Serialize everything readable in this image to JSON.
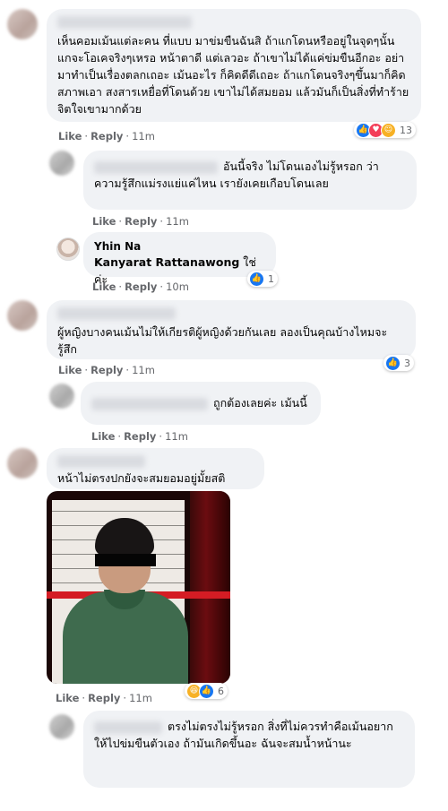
{
  "labels": {
    "like": "Like",
    "reply": "Reply",
    "dot": "·"
  },
  "comments": [
    {
      "text": "เห็นคอมเม้นแต่ละคน ที่แบบ มาข่มขืนฉันสิ ถ้าแกโดนหรืออยู่ในจุดๆนั้น แกจะโอเคจริงๆเหรอ หน้าตาดี แต่เลวอะ ถ้าเขาไม่ได้แค่ข่มขืนอีกอะ อย่ามาทำเป็นเรื่องตลกเถอะ เม้นอะไร ก็คิดดีดีเถอะ ถ้าแกโดนจริงๆขึ้นมาก็คิดสภาพเอา สงสารเหยื่อที่โดนด้วย เขาไม่ได้สมยอม แล้วมันก็เป็นสิ่งที่ทำร้ายจิตใจเขามากด้วย",
      "time": "11m",
      "reactions": {
        "count": "13",
        "icons": [
          "like-reaction",
          "love-reaction",
          "care-reaction"
        ]
      }
    },
    {
      "text": "อันนี้จริง ไม่โดนเองไม่รู้หรอก ว่าความรู้สึกแม่รงแย่แค่ไหน เรายังเคยเกือบโดนเลย",
      "time": "11m"
    },
    {
      "name": "Yhin Na",
      "mention": "Kanyarat Rattanawong",
      "text": "ใช่ค่ะ",
      "time": "10m",
      "reactions": {
        "count": "1",
        "icons": [
          "like-reaction"
        ]
      }
    },
    {
      "text": "ผู้หญิงบางคนเม้นไม่ให้เกียรติผู้หญิงด้วยกันเลย ลองเป็นคุณบ้างไหมจะรู้สึก",
      "time": "11m",
      "reactions": {
        "count": "3",
        "icons": [
          "like-reaction"
        ]
      }
    },
    {
      "text": "ถูกต้องเลยค่ะ เม้นนี้",
      "time": "11m"
    },
    {
      "text": "หน้าไม่ตรงปกยังจะสมยอมอยู่มั้ยสติ",
      "time": "11m",
      "reactions": {
        "count": "6",
        "icons": [
          "haha-reaction",
          "like-reaction"
        ]
      }
    },
    {
      "text": "ตรงไม่ตรงไม่รู้หรอก สิ่งที่ไม่ควรทำคือเม้นอยากให้ไปข่มขืนตัวเอง ถ้ามันเกิดขึ้นอะ ฉันจะสมน้ำหน้านะ"
    }
  ],
  "colors": {
    "bubble": "#f0f2f5",
    "meta": "#65676b",
    "like_blue": "#1877f2",
    "love_red": "#f33e58",
    "care_yellow": "#f7b125"
  }
}
